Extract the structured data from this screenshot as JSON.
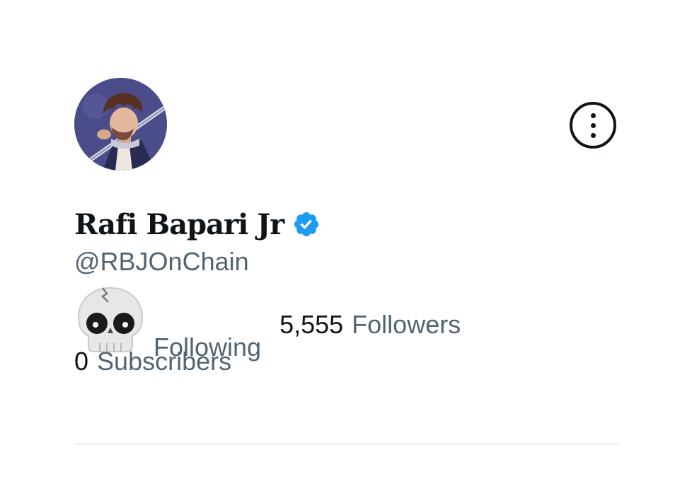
{
  "profile": {
    "display_name": "Rafi Bapari Jr",
    "handle": "@RBJOnChain",
    "verified": true,
    "avatar": "anime-character-with-sword"
  },
  "stats": {
    "following_count_icon": "skull-emoji",
    "following_label": "Following",
    "followers_count": "5,555",
    "followers_label": "Followers",
    "subscribers_count": "0",
    "subscribers_label": "Subscribers"
  },
  "actions": {
    "more_icon": "more-options-icon"
  },
  "colors": {
    "text_primary": "#0f1419",
    "text_secondary": "#536471",
    "verified_badge": "#1d9bf0",
    "divider": "#cfd9de"
  }
}
